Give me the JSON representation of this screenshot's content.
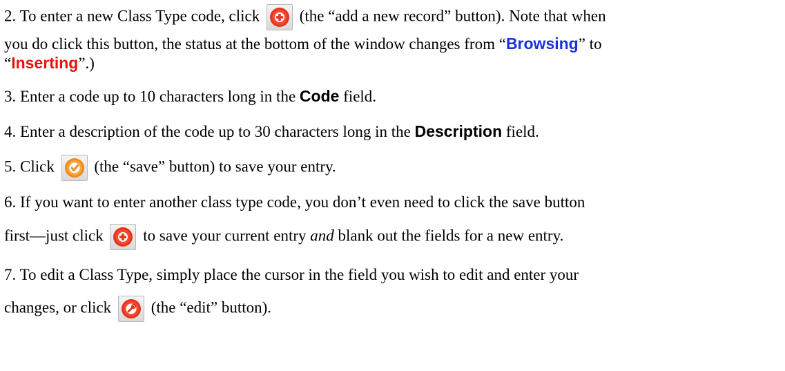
{
  "steps": [
    {
      "num": "2.",
      "pre": "To enter a new Class Type code, click",
      "post": "(the “add a new record” button). Note that when",
      "line2": "you do click this button, the status at the bottom of the window changes from “",
      "browsing": "Browsing",
      "mid": "” to",
      "open_quote": "“",
      "inserting": "Inserting",
      "end": "”.)"
    },
    {
      "num": "3.",
      "pre": "Enter a code up to 10 characters long in the",
      "bold": "Code",
      "post": "field."
    },
    {
      "num": "4.",
      "pre": "Enter a description of the code up to 30 characters long in the",
      "bold": "Description",
      "post": "field."
    },
    {
      "num": "5.",
      "pre": "Click",
      "post": "(the “save” button) to save your entry."
    },
    {
      "num": "6.",
      "line1": "If you want to enter another class type code, you don’t even need to click the save button",
      "pre": "first—just click",
      "post": "to save your current entry",
      "em": "and",
      "post2": "blank out the fields for a new entry."
    },
    {
      "num": "7.",
      "line1": "To edit a Class Type, simply place the cursor in the field you wish to edit and enter your",
      "pre": "changes, or click",
      "post": "(the “edit” button)."
    }
  ],
  "icons": {
    "add": "add-record-icon",
    "save": "save-icon",
    "edit": "edit-icon"
  },
  "colors": {
    "browsing": "#1a33d8",
    "inserting": "#e8120c",
    "add_icon": "#e8321c",
    "save_icon": "#f08a1c",
    "edit_icon": "#e8321c"
  }
}
